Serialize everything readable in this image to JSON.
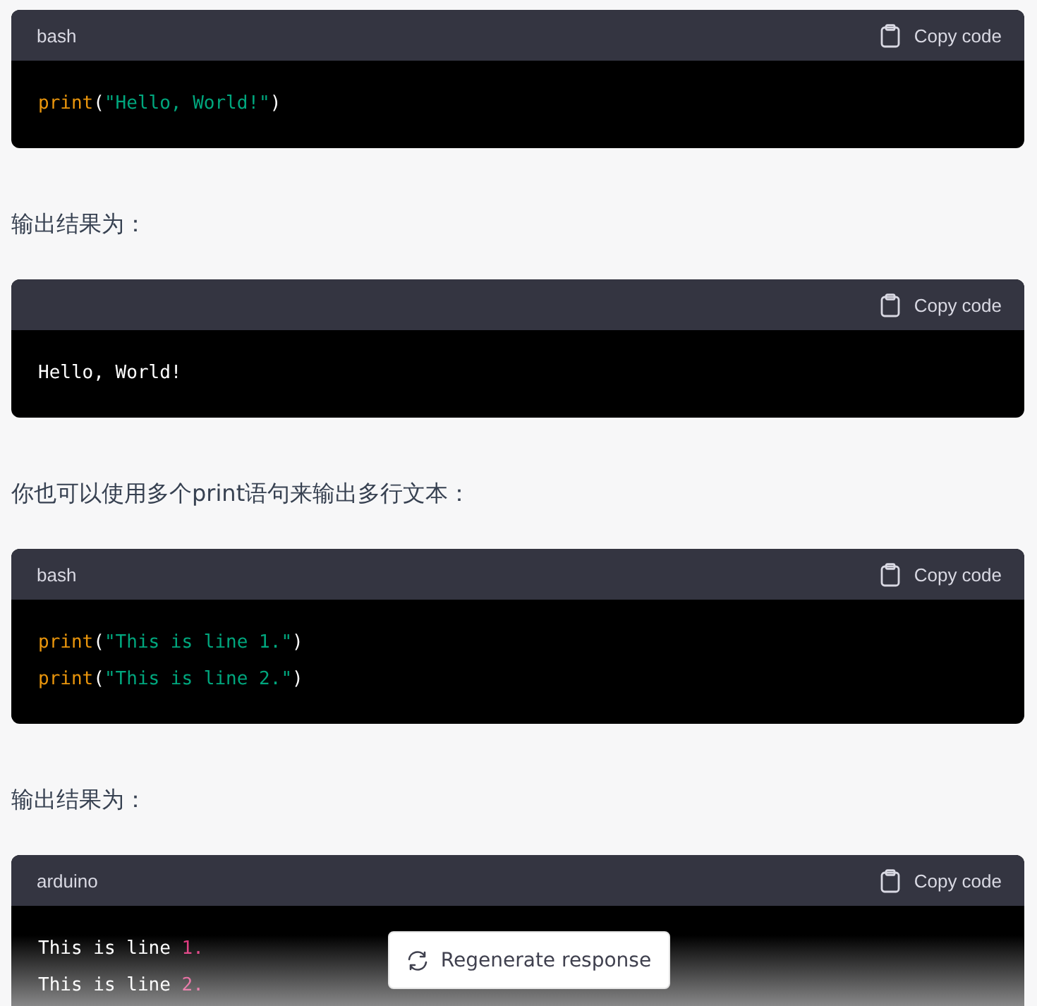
{
  "blocks": [
    {
      "kind": "code",
      "language": "bash",
      "copy_label": "Copy code",
      "lines": [
        [
          {
            "kind": "function",
            "text": "print"
          },
          {
            "kind": "punct",
            "text": "("
          },
          {
            "kind": "string",
            "text": "\"Hello, World!\""
          },
          {
            "kind": "punct",
            "text": ")"
          }
        ]
      ]
    },
    {
      "kind": "paragraph",
      "text": "输出结果为："
    },
    {
      "kind": "code",
      "copy_label": "Copy code",
      "lines": [
        [
          {
            "kind": "plain",
            "text": "Hello, World!"
          }
        ]
      ]
    },
    {
      "kind": "paragraph",
      "text": "你也可以使用多个print语句来输出多行文本："
    },
    {
      "kind": "code",
      "language": "bash",
      "copy_label": "Copy code",
      "lines": [
        [
          {
            "kind": "function",
            "text": "print"
          },
          {
            "kind": "punct",
            "text": "("
          },
          {
            "kind": "string",
            "text": "\"This is line 1.\""
          },
          {
            "kind": "punct",
            "text": ")"
          }
        ],
        [
          {
            "kind": "function",
            "text": "print"
          },
          {
            "kind": "punct",
            "text": "("
          },
          {
            "kind": "string",
            "text": "\"This is line 2.\""
          },
          {
            "kind": "punct",
            "text": ")"
          }
        ]
      ]
    },
    {
      "kind": "paragraph",
      "text": "输出结果为："
    },
    {
      "kind": "code",
      "language": "arduino",
      "copy_label": "Copy code",
      "lines": [
        [
          {
            "kind": "plain",
            "text": "This is line "
          },
          {
            "kind": "number",
            "text": "1."
          }
        ],
        [
          {
            "kind": "plain",
            "text": "This is line "
          },
          {
            "kind": "number",
            "text": "2."
          }
        ]
      ]
    }
  ],
  "regenerate_button": {
    "label": "Regenerate response"
  }
}
